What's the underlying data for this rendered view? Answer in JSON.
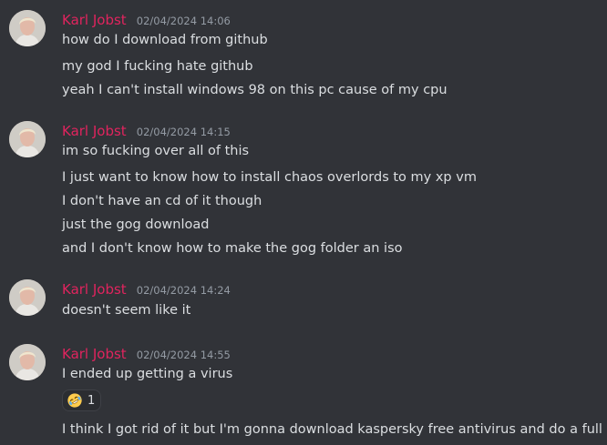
{
  "messages": [
    {
      "author": "Karl Jobst",
      "timestamp": "02/04/2024 14:06",
      "lines": [
        "how do I download from github",
        "my god I fucking hate github",
        "yeah I can't install windows 98 on this pc cause of my cpu"
      ]
    },
    {
      "author": "Karl Jobst",
      "timestamp": "02/04/2024 14:15",
      "lines": [
        "im so fucking over all of this",
        "I just want to know how to install chaos overlords to my xp vm",
        "I don't have an cd of it though",
        "just the gog download",
        "and I don't know how to make the gog folder an iso"
      ]
    },
    {
      "author": "Karl Jobst",
      "timestamp": "02/04/2024 14:24",
      "lines": [
        "doesn't seem like it"
      ]
    },
    {
      "author": "Karl Jobst",
      "timestamp": "02/04/2024 14:55",
      "lines": [
        "I ended up getting a virus",
        "I think I got rid of it but I'm gonna download kaspersky free antivirus and do a full scan"
      ],
      "reaction": {
        "emoji": "rolling-on-floor-laughing-icon",
        "count": "1"
      }
    }
  ],
  "colors": {
    "background": "#313338",
    "author": "#e0245e",
    "timestamp": "#949ba4",
    "text": "#dbdee1"
  }
}
